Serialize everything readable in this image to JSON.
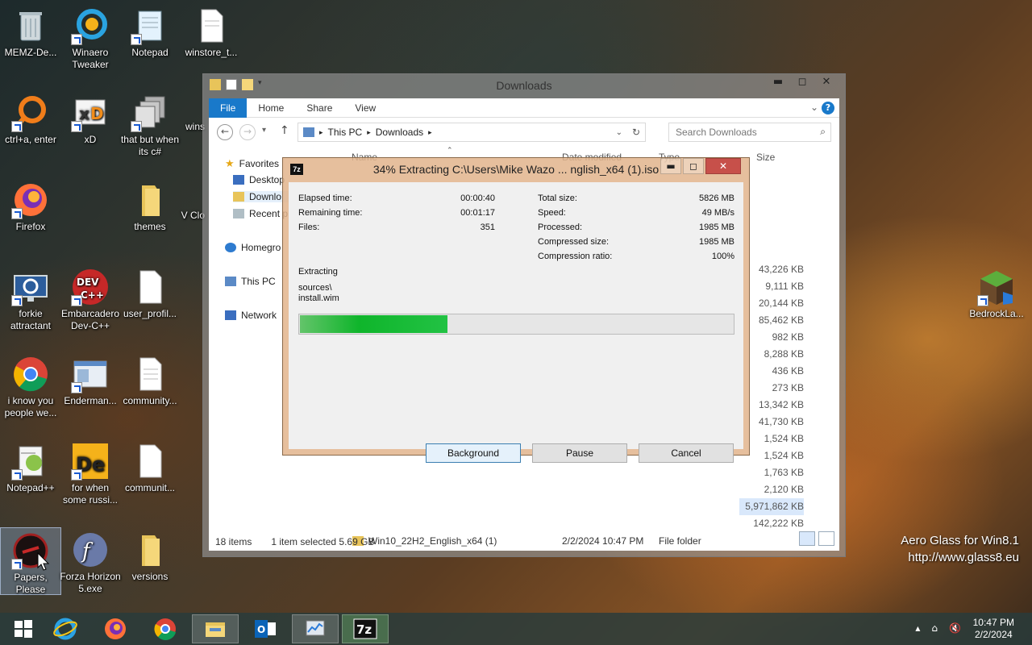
{
  "desktop": {
    "icons": [
      {
        "label": "MEMZ-De..."
      },
      {
        "label": "Winaero Tweaker"
      },
      {
        "label": "Notepad"
      },
      {
        "label": "winstore_t..."
      },
      {
        "label": "ctrl+a, enter"
      },
      {
        "label": "xD"
      },
      {
        "label": "that but when its c#"
      },
      {
        "label": "wins"
      },
      {
        "label": "Firefox"
      },
      {
        "label": "themes"
      },
      {
        "label": "V Clo"
      },
      {
        "label": "forkie attractant"
      },
      {
        "label": "Embarcadero Dev-C++"
      },
      {
        "label": "user_profil..."
      },
      {
        "label": "i know you people we..."
      },
      {
        "label": "Enderman..."
      },
      {
        "label": "community..."
      },
      {
        "label": "Notepad++"
      },
      {
        "label": "for when some russi..."
      },
      {
        "label": "communit..."
      },
      {
        "label": "Papers, Please"
      },
      {
        "label": "Forza Horizon 5.exe"
      },
      {
        "label": "versions"
      },
      {
        "label": "BedrockLa..."
      }
    ],
    "watermark": {
      "line1": "Aero Glass for Win8.1",
      "line2": "http://www.glass8.eu"
    }
  },
  "explorer": {
    "title": "Downloads",
    "window_buttons": {
      "minimize": "▬",
      "maximize": "◻",
      "close": "✕"
    },
    "ribbon_tabs": [
      "File",
      "Home",
      "Share",
      "View"
    ],
    "breadcrumb": [
      "This PC",
      "Downloads"
    ],
    "search_placeholder": "Search Downloads",
    "nav": [
      "Favorites",
      "Desktop",
      "Downlo",
      "Recent p",
      "Homegro",
      "This PC",
      "Network"
    ],
    "columns": {
      "name": "Name",
      "date": "Date modified",
      "type": "Type",
      "size": "Size"
    },
    "sizes": [
      "43,226 KB",
      "9,111 KB",
      "20,144 KB",
      "85,462 KB",
      "982 KB",
      "8,288 KB",
      "436 KB",
      "273 KB",
      "13,342 KB",
      "41,730 KB",
      "1,524 KB",
      "1,524 KB",
      "1,763 KB",
      "2,120 KB",
      "5,971,862 KB",
      "142,222 KB"
    ],
    "folder_row": {
      "name": "Win10_22H2_English_x64 (1)",
      "date": "2/2/2024 10:47 PM",
      "type": "File folder"
    },
    "status": {
      "items": "18 items",
      "selected": "1 item selected  5.69 GB"
    }
  },
  "dialog": {
    "title": "34% Extracting C:\\Users\\Mike Wazo ... nglish_x64 (1).iso",
    "left_stats": [
      {
        "k": "Elapsed time:",
        "v": "00:00:40"
      },
      {
        "k": "Remaining time:",
        "v": "00:01:17"
      },
      {
        "k": "Files:",
        "v": "351"
      }
    ],
    "right_stats": [
      {
        "k": "Total size:",
        "v": "5826 MB"
      },
      {
        "k": "Speed:",
        "v": "49 MB/s"
      },
      {
        "k": "Processed:",
        "v": "1985 MB"
      },
      {
        "k": "Compressed size:",
        "v": "1985 MB"
      },
      {
        "k": "Compression ratio:",
        "v": "100%"
      }
    ],
    "operation": "Extracting",
    "path_line1": "sources\\",
    "path_line2": "install.wim",
    "progress_fraction": 0.34,
    "buttons": {
      "background": "Background",
      "pause": "Pause",
      "cancel": "Cancel"
    }
  },
  "taskbar": {
    "time": "10:47 PM",
    "date": "2/2/2024"
  }
}
